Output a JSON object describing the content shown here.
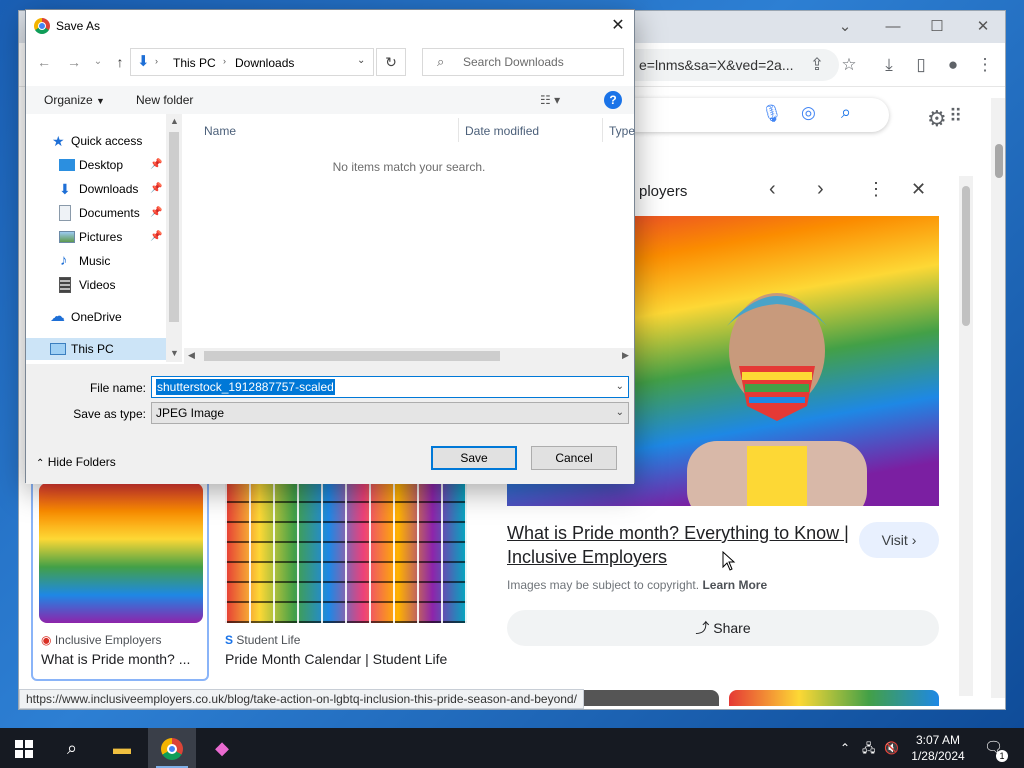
{
  "chrome": {
    "omnibox_text": "e=lnms&sa=X&ved=2a...",
    "status_url": "https://www.inclusiveemployers.co.uk/blog/take-action-on-lgbtq-inclusion-this-pride-season-and-beyond/"
  },
  "results": [
    {
      "source": "Inclusive Employers",
      "title": "What is Pride month? ..."
    },
    {
      "source": "Student Life",
      "title": "Pride Month Calendar | Student Life"
    }
  ],
  "side_panel": {
    "header_fragment": "ployers",
    "title": "What is Pride month? Everything to Know | Inclusive Employers",
    "visit_label": "Visit",
    "copyright_text": "Images may be subject to copyright.",
    "learn_more": "Learn More",
    "share_label": "Share"
  },
  "dialog": {
    "title": "Save As",
    "breadcrumb": [
      "This PC",
      "Downloads"
    ],
    "search_placeholder": "Search Downloads",
    "organize_label": "Organize",
    "new_folder_label": "New folder",
    "nav_items": [
      {
        "label": "Quick access"
      },
      {
        "label": "Desktop"
      },
      {
        "label": "Downloads"
      },
      {
        "label": "Documents"
      },
      {
        "label": "Pictures"
      },
      {
        "label": "Music"
      },
      {
        "label": "Videos"
      },
      {
        "label": "OneDrive"
      },
      {
        "label": "This PC"
      }
    ],
    "columns": [
      "Name",
      "Date modified",
      "Type"
    ],
    "empty_message": "No items match your search.",
    "file_name_label": "File name:",
    "file_name_value": "shutterstock_1912887757-scaled",
    "save_type_label": "Save as type:",
    "save_type_value": "JPEG Image",
    "hide_folders_label": "Hide Folders",
    "save_label": "Save",
    "cancel_label": "Cancel"
  },
  "taskbar": {
    "time": "3:07 AM",
    "date": "1/28/2024",
    "notification_count": "1"
  },
  "colors": {
    "accent": "#0078d7",
    "taskbar": "#161a22"
  }
}
